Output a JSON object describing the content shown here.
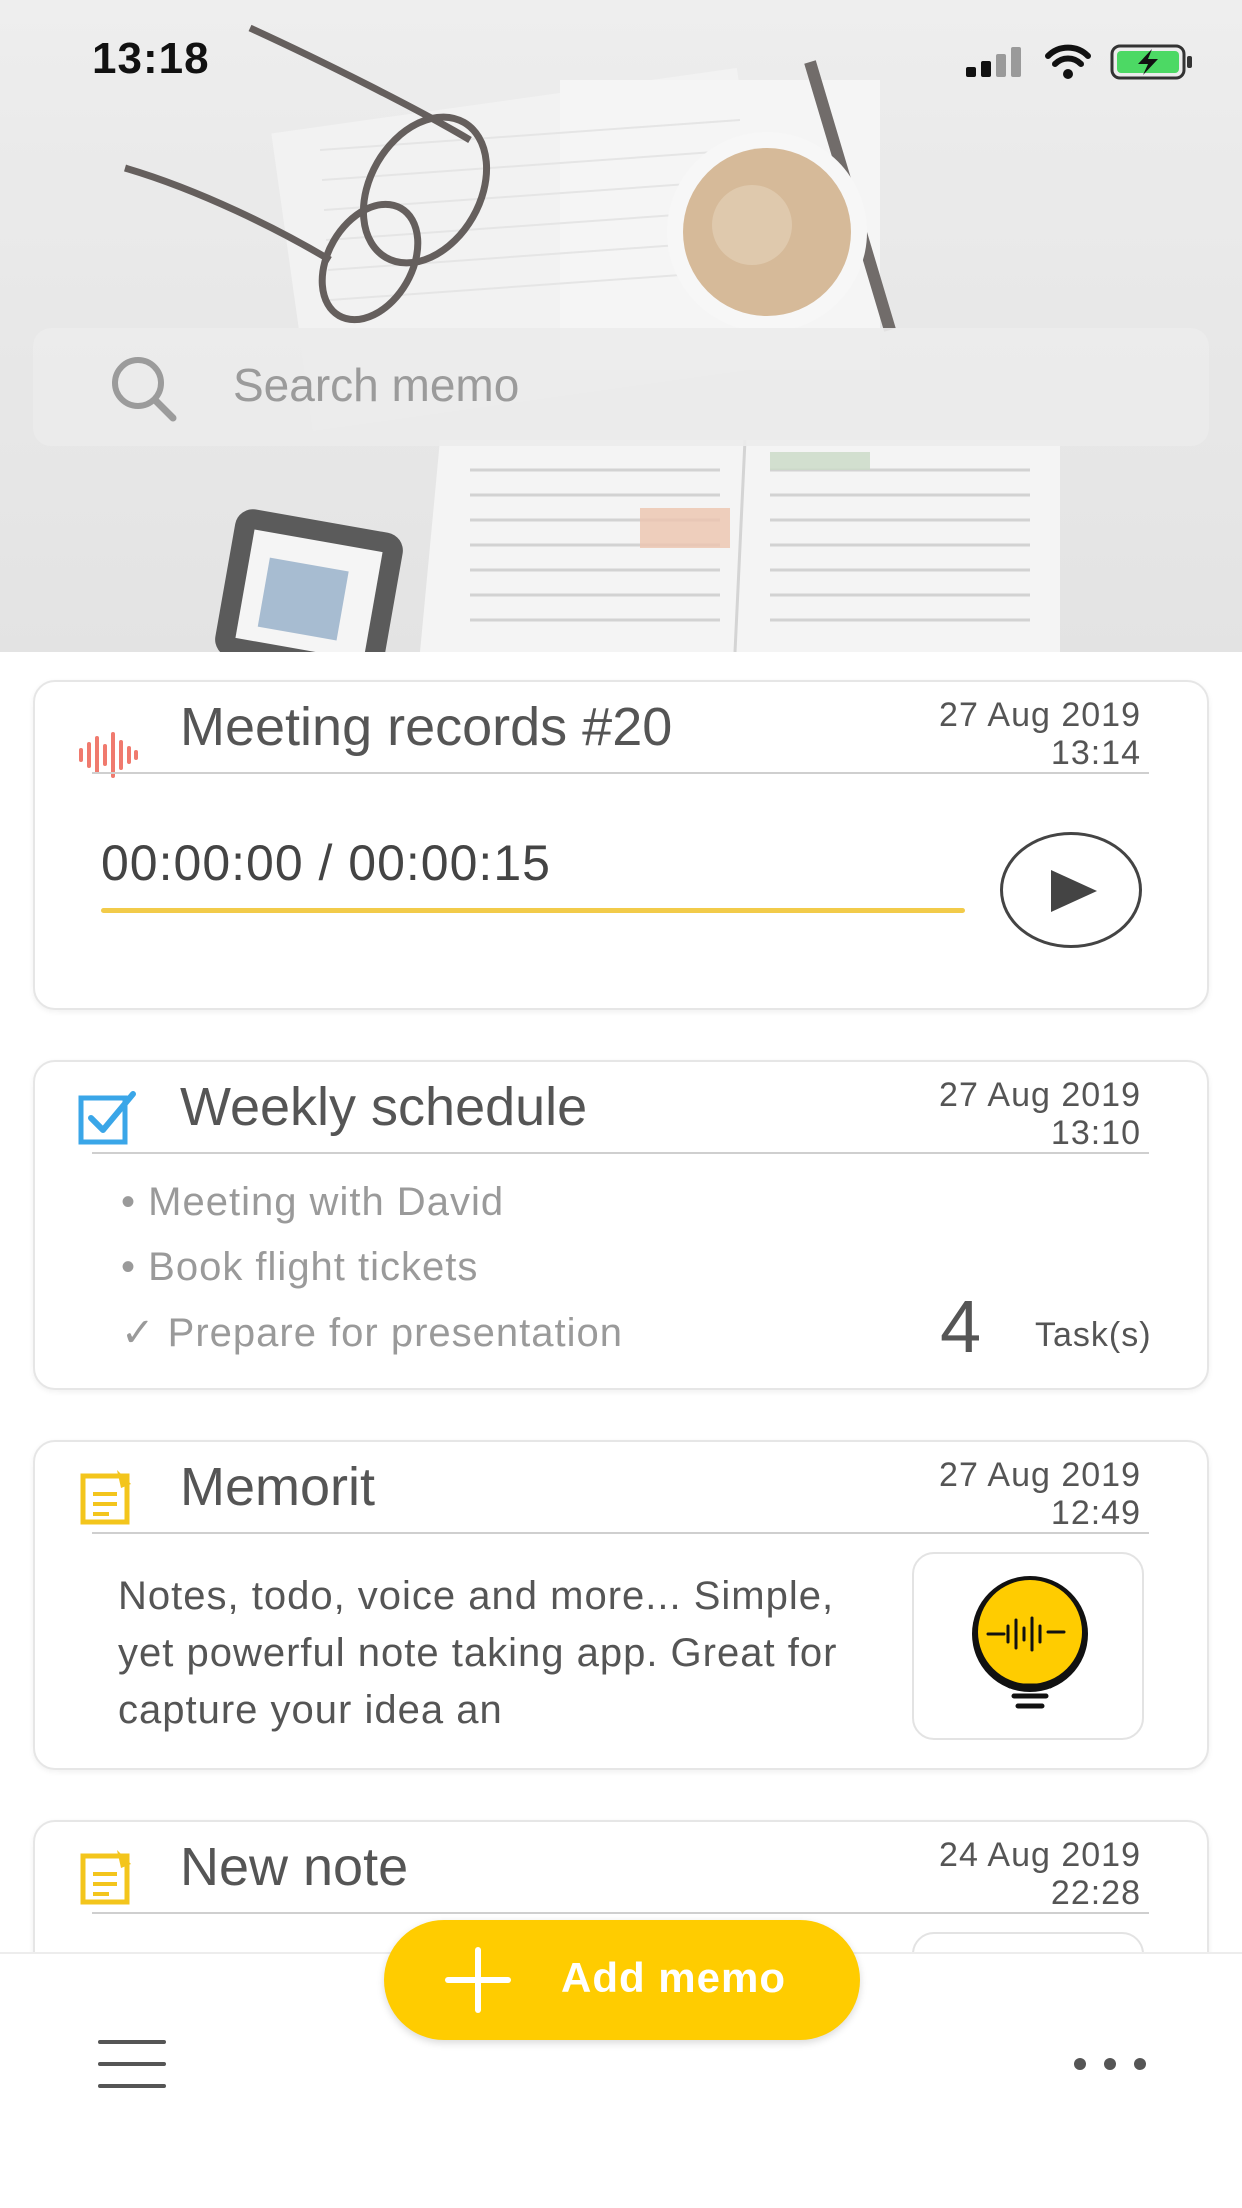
{
  "status_bar": {
    "time": "13:18",
    "icons": [
      "cellular-signal-icon",
      "wifi-icon",
      "battery-charging-icon"
    ]
  },
  "search": {
    "placeholder": "Search memo",
    "icon": "search-icon"
  },
  "memos": [
    {
      "type": "voice",
      "icon": "sound-wave-icon",
      "title": "Meeting records #20",
      "date": "27 Aug 2019",
      "time": "13:14",
      "playback": "00:00:00 / 00:00:15",
      "progress": 0
    },
    {
      "type": "todo",
      "icon": "checkbox-icon",
      "title": "Weekly schedule",
      "date": "27 Aug 2019",
      "time": "13:10",
      "tasks": [
        {
          "label": "Meeting with David",
          "marker": "•",
          "done": false
        },
        {
          "label": "Book flight tickets",
          "marker": "•",
          "done": false
        },
        {
          "label": "Prepare for presentation",
          "marker": "✓",
          "done": true
        }
      ],
      "task_count": "4",
      "task_unit": "Task(s)"
    },
    {
      "type": "note",
      "icon": "note-icon",
      "title": "Memorit",
      "date": "27 Aug 2019",
      "time": "12:49",
      "body": "Notes, todo, voice and more... Simple, yet powerful note taking app. Great for capture your idea an"
    },
    {
      "type": "note",
      "icon": "note-icon",
      "title": "New note",
      "date": "24 Aug 2019",
      "time": "22:28"
    }
  ],
  "bottom_bar": {
    "add_label": "Add memo",
    "menu_icon": "hamburger-menu-icon",
    "more_icon": "more-dots-icon"
  },
  "colors": {
    "accent": "#ffcc00",
    "progress": "#f2cb4a",
    "voice_icon": "#f07a6e",
    "todo_icon": "#3aa6e8",
    "note_icon": "#f3c51c"
  }
}
